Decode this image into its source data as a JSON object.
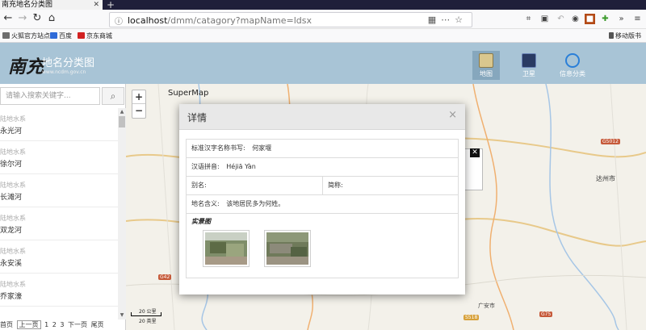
{
  "browser": {
    "tab_title": "南充地名分类图",
    "url_host": "localhost",
    "url_path": "/dmm/catagory?mapName=ldsx",
    "bookmarks": [
      {
        "label": "火狐官方站点",
        "color": "#6d6d6d"
      },
      {
        "label": "百度",
        "color": "#2f6bd8"
      },
      {
        "label": "京东商城",
        "color": "#d22222"
      }
    ],
    "mobile_bookmarks": "移动版书签"
  },
  "app": {
    "logo_glyph": "南充",
    "title": "地名分类图",
    "subtitle": "www.ncdm.gov.cn",
    "modes": [
      {
        "label": "地图",
        "active": true
      },
      {
        "label": "卫星",
        "active": false
      },
      {
        "label": "信息分类",
        "active": false
      }
    ]
  },
  "sidebar": {
    "search_placeholder": "请输入搜索关键字...",
    "items": [
      {
        "category": "陆地水系",
        "name": "永光河"
      },
      {
        "category": "陆地水系",
        "name": "徐尔河"
      },
      {
        "category": "陆地水系",
        "name": "长滩河"
      },
      {
        "category": "陆地水系",
        "name": "双龙河"
      },
      {
        "category": "陆地水系",
        "name": "永安溪"
      },
      {
        "category": "陆地水系",
        "name": "乔家濠"
      }
    ],
    "pager": {
      "first": "首页",
      "prev": "上一页",
      "pages": [
        "1",
        "2",
        "3"
      ],
      "next": "下一页",
      "last": "尾页"
    }
  },
  "map": {
    "brand": "SuperMap",
    "zoom_in": "+",
    "zoom_out": "−",
    "scale_top": "20 公里",
    "scale_bottom": "20 英里",
    "road_badges": [
      "G5012",
      "G42",
      "G75",
      "S518"
    ],
    "place_labels": [
      "达州市",
      "广安市"
    ]
  },
  "modal": {
    "title": "详情",
    "close": "×",
    "fields": {
      "standard_name_label": "标准汉字名称书写:",
      "standard_name_value": "何家堰",
      "pinyin_label": "汉语拼音:",
      "pinyin_value": "Héjiā Yàn",
      "alias_label": "别名:",
      "alias_value": "",
      "short_label": "简称:",
      "short_value": "",
      "meaning_label": "地名含义:",
      "meaning_value": "该地居民多为何姓。"
    },
    "photos_title": "实景图"
  }
}
